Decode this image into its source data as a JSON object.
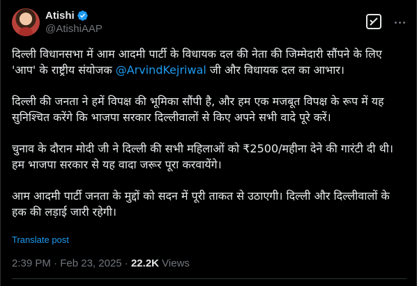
{
  "author": {
    "display_name": "Atishi",
    "handle": "@AtishiAAP",
    "verified_color": "#1d9bf0"
  },
  "header_icons": {
    "grok": "grok-icon",
    "more": "more-options-icon"
  },
  "post": {
    "p1_before": "दिल्ली विधानसभा में आम आदमी पार्टी के विधायक दल की नेता की जिम्मेदारी सौंपने के लिए 'आप' के राष्ट्रीय संयोजक ",
    "p1_mention": "@ArvindKejriwal",
    "p1_after": " जी और विधायक दल का आभार।",
    "p2": "दिल्ली की जनता ने हमें विपक्ष की भूमिका सौंपी है, और हम एक मजबूत विपक्ष के रूप में यह सुनिश्चित करेंगे कि भाजपा सरकार दिल्लीवालों से किए अपने सभी वादे पूरे करें।",
    "p3": "चुनाव के दौरान मोदी जी ने दिल्ली की सभी महिलाओं को ₹2500/महीना देने की गारंटी दी थी। हम भाजपा सरकार से यह वादा जरूर पूरा करवायेंगे।",
    "p4": "आम आदमी पार्टी जनता के मुद्दों को सदन में पूरी ताकत से उठाएगी। दिल्ली और दिल्लीवालों के हक की लड़ाई जारी रहेगी।"
  },
  "translate_label": "Translate post",
  "meta": {
    "time": "2:39 PM",
    "separator": " · ",
    "date": "Feb 23, 2025",
    "views_count": "22.2K",
    "views_label": " Views"
  },
  "colors": {
    "background": "#000000",
    "text": "#e7e9ea",
    "muted": "#71767b",
    "accent": "#1d9bf0"
  }
}
